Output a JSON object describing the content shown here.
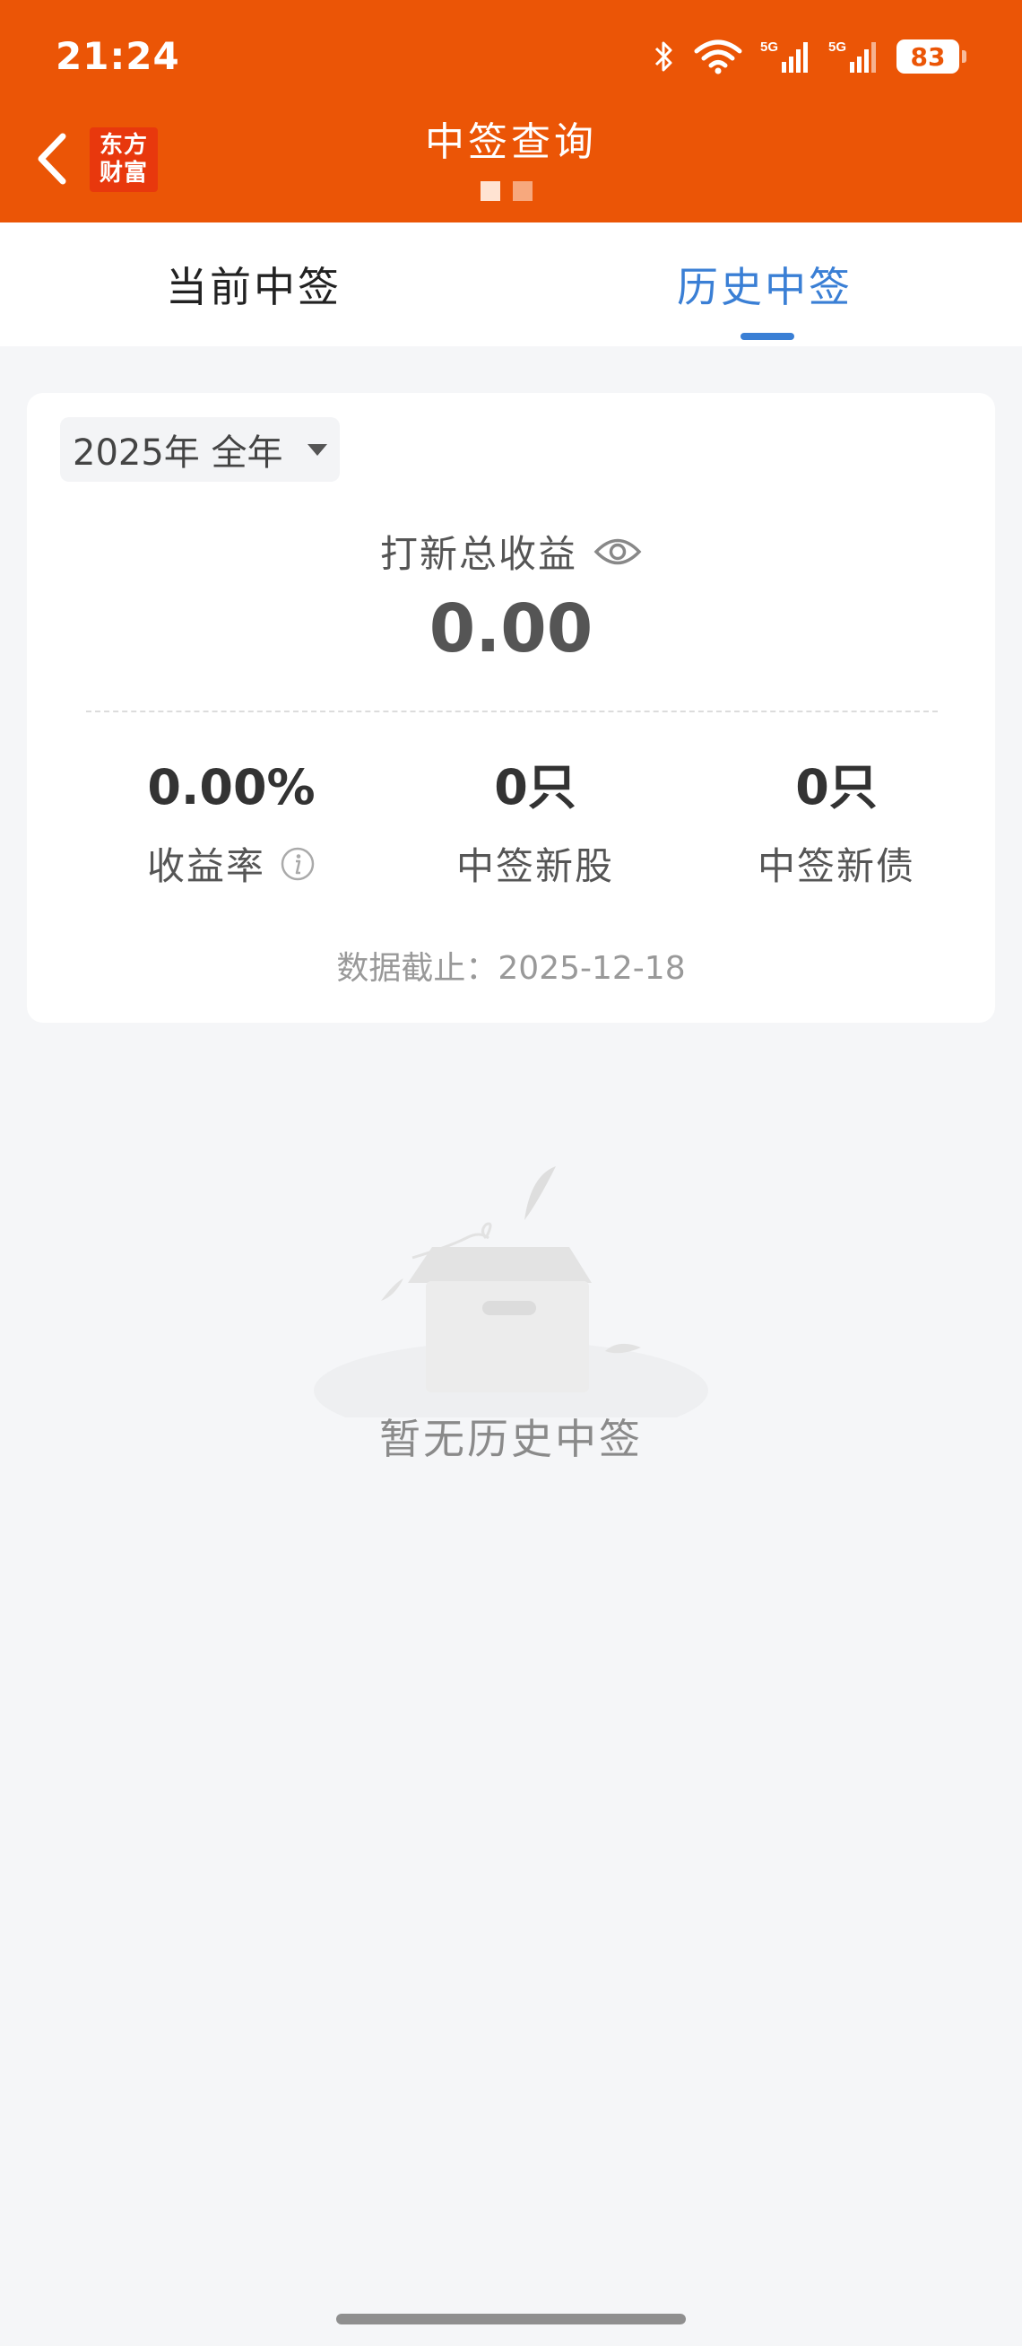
{
  "status_bar": {
    "time": "21:24",
    "battery": "83",
    "network": "5G"
  },
  "header": {
    "title": "中签查询",
    "logo_line1": "东方",
    "logo_line2": "财富"
  },
  "tabs": [
    {
      "label": "当前中签",
      "active": false
    },
    {
      "label": "历史中签",
      "active": true
    }
  ],
  "summary": {
    "year_filter": "2025年 全年",
    "total_label": "打新总收益",
    "total_value": "0.00",
    "stats": [
      {
        "value": "0.00%",
        "label": "收益率"
      },
      {
        "value": "0只",
        "label": "中签新股"
      },
      {
        "value": "0只",
        "label": "中签新债"
      }
    ],
    "data_date": "数据截止：2025-12-18"
  },
  "empty_state": {
    "text": "暂无历史中签"
  },
  "colors": {
    "header_bg": "#eb5506",
    "active_tab": "#3a7fd5",
    "page_bg": "#f5f6f8"
  },
  "icons": [
    "back-arrow-icon",
    "bluetooth-icon",
    "wifi-icon",
    "signal-icon",
    "eye-icon",
    "info-icon",
    "caret-down-icon",
    "empty-box-icon"
  ]
}
